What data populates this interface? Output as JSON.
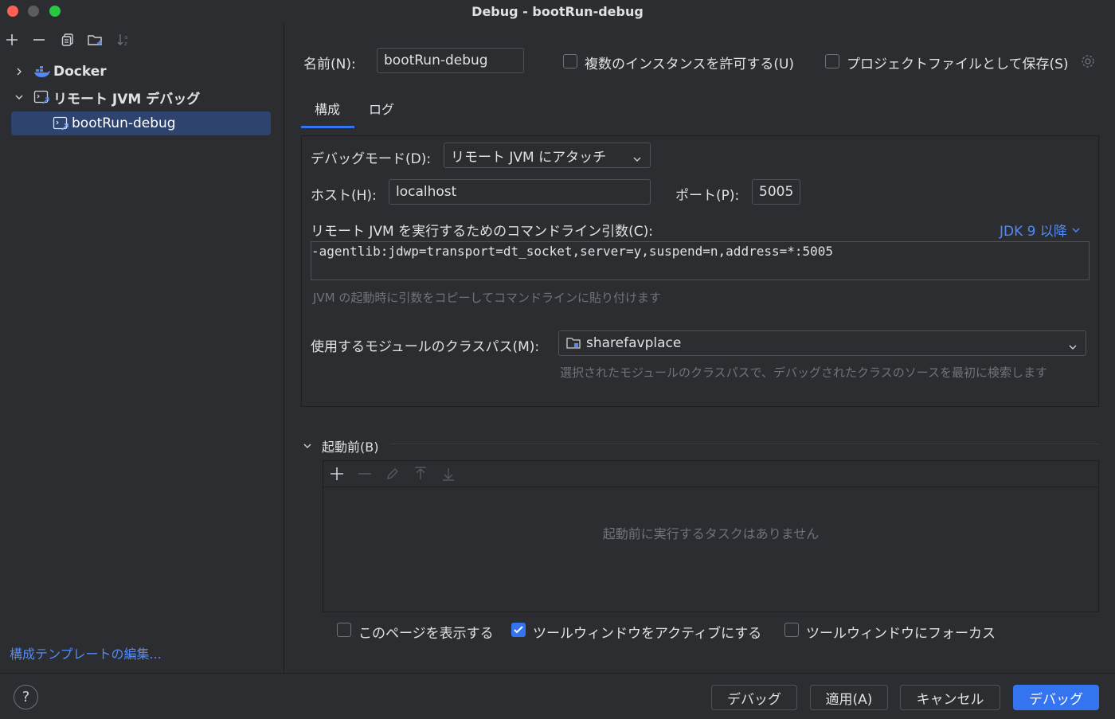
{
  "window": {
    "title": "Debug - bootRun-debug"
  },
  "sidebar": {
    "tree": [
      {
        "label": "Docker"
      },
      {
        "label": "リモート JVM デバッグ"
      },
      {
        "label": "bootRun-debug"
      }
    ],
    "edit_templates_link": "構成テンプレートの編集..."
  },
  "form": {
    "name_label": "名前(N):",
    "name_value": "bootRun-debug",
    "allow_multiple_label": "複数のインスタンスを許可する(U)",
    "save_as_project_file_label": "プロジェクトファイルとして保存(S)",
    "tabs": [
      {
        "label": "構成",
        "active": true
      },
      {
        "label": "ログ",
        "active": false
      }
    ]
  },
  "config": {
    "debug_mode_label": "デバッグモード(D):",
    "debug_mode_value": "リモート JVM にアタッチ",
    "host_label": "ホスト(H):",
    "host_value": "localhost",
    "port_label": "ポート(P):",
    "port_value": "5005",
    "cmdline_label": "リモート JVM を実行するためのコマンドライン引数(C):",
    "jdk_select": "JDK 9 以降",
    "cmdline_value": "-agentlib:jdwp=transport=dt_socket,server=y,suspend=n,address=*:5005",
    "cmdline_hint": "JVM の起動時に引数をコピーしてコマンドラインに貼り付けます",
    "module_label": "使用するモジュールのクラスパス(M):",
    "module_value": "sharefavplace",
    "module_hint": "選択されたモジュールのクラスパスで、デバッグされたクラスのソースを最初に検索します"
  },
  "before_launch": {
    "title": "起動前(B)",
    "empty_text": "起動前に実行するタスクはありません"
  },
  "options": {
    "show_page_label": "このページを表示する",
    "show_page_checked": false,
    "activate_tool_window_label": "ツールウィンドウをアクティブにする",
    "activate_tool_window_checked": true,
    "focus_tool_window_label": "ツールウィンドウにフォーカス",
    "focus_tool_window_checked": false
  },
  "buttons": {
    "help": "?",
    "debug": "デバッグ",
    "apply": "適用(A)",
    "cancel": "キャンセル",
    "debug_primary": "デバッグ"
  },
  "colors": {
    "accent": "#3574f0",
    "link": "#548af7",
    "selection": "#2e436e",
    "background": "#2b2d30"
  }
}
